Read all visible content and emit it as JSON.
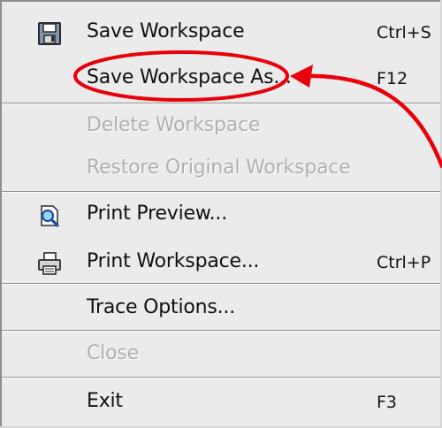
{
  "menu": {
    "items": [
      {
        "label": "Save Workspace",
        "shortcut": "Ctrl+S",
        "icon": "save-icon",
        "enabled": true
      },
      {
        "label": "Save Workspace As...",
        "shortcut": "F12",
        "icon": null,
        "enabled": true
      },
      {
        "label": "Delete Workspace",
        "shortcut": "",
        "icon": null,
        "enabled": false
      },
      {
        "label": "Restore Original Workspace",
        "shortcut": "",
        "icon": null,
        "enabled": false
      },
      {
        "label": "Print Preview...",
        "shortcut": "",
        "icon": "print-preview-icon",
        "enabled": true
      },
      {
        "label": "Print Workspace...",
        "shortcut": "Ctrl+P",
        "icon": "printer-icon",
        "enabled": true
      },
      {
        "label": "Trace Options...",
        "shortcut": "",
        "icon": null,
        "enabled": true
      },
      {
        "label": "Close",
        "shortcut": "",
        "icon": null,
        "enabled": false
      },
      {
        "label": "Exit",
        "shortcut": "F3",
        "icon": null,
        "enabled": true
      }
    ]
  },
  "annotation": {
    "target": "Save Workspace As...",
    "color": "#e8000b"
  },
  "colors": {
    "menu_background": "#ebebeb",
    "disabled_text": "#b0b0b0"
  }
}
